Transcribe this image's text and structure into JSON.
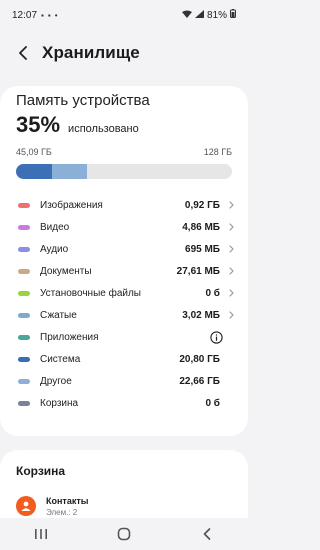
{
  "status": {
    "time": "12:07",
    "battery_text": "81%"
  },
  "header": {
    "title": "Хранилище",
    "back_icon": "back-arrow-icon"
  },
  "storage": {
    "card_title": "Память устройства",
    "percent": "35%",
    "percent_label": "использовано",
    "used": "45,09 ГБ",
    "total": "128 ГБ",
    "bar_segments": [
      {
        "fraction": 0.165,
        "color": "#3c6fb5"
      },
      {
        "fraction": 0.165,
        "color": "#8ab0d8"
      }
    ]
  },
  "categories": [
    {
      "label": "Изображения",
      "value": "0,92 ГБ",
      "color": "#f07070",
      "chevron": true
    },
    {
      "label": "Видео",
      "value": "4,86 МБ",
      "color": "#cc7ae0",
      "chevron": true
    },
    {
      "label": "Аудио",
      "value": "695 МБ",
      "color": "#8d8ee6",
      "chevron": true
    },
    {
      "label": "Документы",
      "value": "27,61 МБ",
      "color": "#c9a98a",
      "chevron": true
    },
    {
      "label": "Установочные файлы",
      "value": "0 б",
      "color": "#9bd43c",
      "chevron": true
    },
    {
      "label": "Сжатые",
      "value": "3,02 МБ",
      "color": "#7fa9c9",
      "chevron": true
    },
    {
      "label": "Приложения",
      "value": "",
      "color": "#4aa89a",
      "info": true
    },
    {
      "label": "Система",
      "value": "20,80 ГБ",
      "color": "#3a6db3",
      "chevron": false
    },
    {
      "label": "Другое",
      "value": "22,66 ГБ",
      "color": "#8faed6",
      "chevron": false
    },
    {
      "label": "Корзина",
      "value": "0 б",
      "color": "#7a8294",
      "chevron": false
    }
  ],
  "trash": {
    "title": "Корзина",
    "items": [
      {
        "label": "Контакты",
        "sub": "Элем.: 2",
        "icon": "contact-icon"
      }
    ]
  },
  "navbar": {
    "buttons": [
      "recents-icon",
      "home-icon",
      "back-icon"
    ]
  },
  "colors": {
    "background": "#f3f3f5",
    "card": "#ffffff",
    "contact_accent": "#f25c1f"
  }
}
